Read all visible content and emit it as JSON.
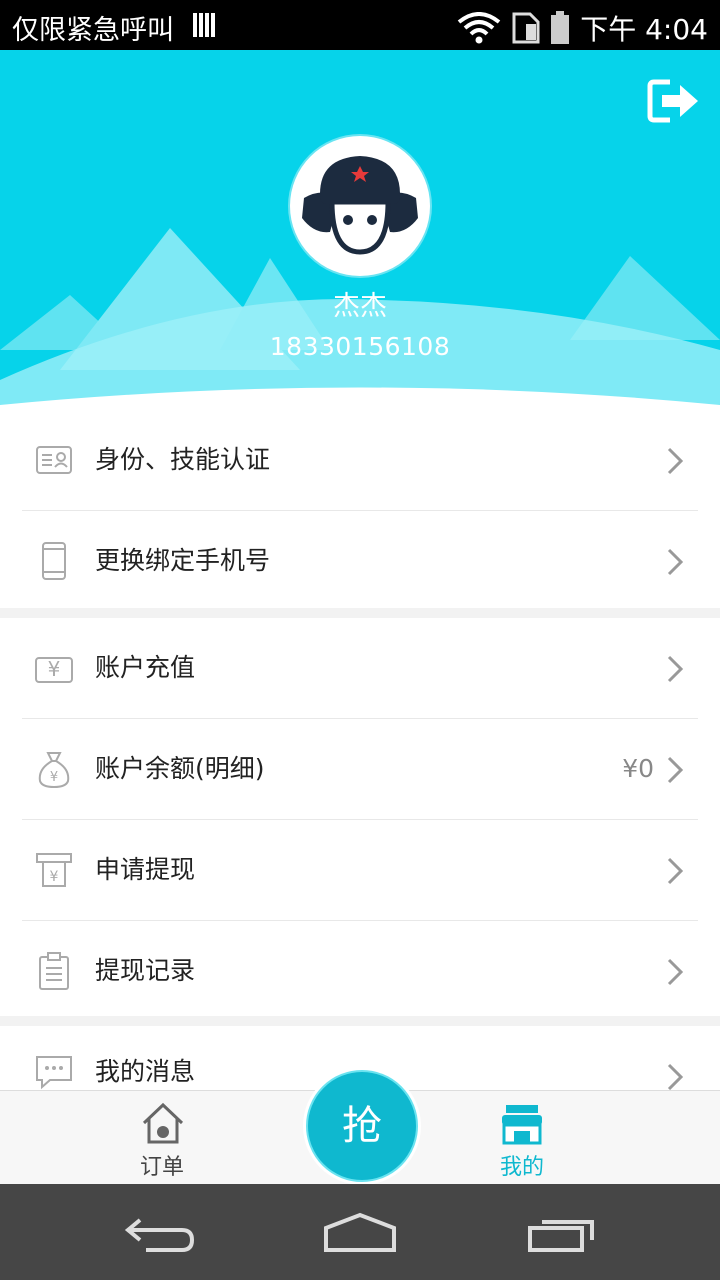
{
  "status_bar": {
    "carrier": "仅限紧急呼叫",
    "time": "下午 4:04"
  },
  "profile": {
    "name": "杰杰",
    "phone": "18330156108"
  },
  "section1": [
    {
      "label": "身份、技能认证",
      "icon": "id-card-icon"
    },
    {
      "label": "更换绑定手机号",
      "icon": "phone-icon"
    }
  ],
  "section2": [
    {
      "label": "账户充值",
      "icon": "recharge-icon"
    },
    {
      "label": "账户余额(明细)",
      "icon": "money-bag-icon",
      "value": "¥0"
    },
    {
      "label": "申请提现",
      "icon": "withdraw-icon"
    },
    {
      "label": "提现记录",
      "icon": "clipboard-icon"
    }
  ],
  "section3": [
    {
      "label": "我的消息",
      "icon": "message-icon"
    }
  ],
  "tabs": {
    "orders": "订单",
    "grab": "抢",
    "mine": "我的"
  },
  "colors": {
    "accent": "#06d3ea",
    "tab_active": "#0fb8cf",
    "grab_button": "#0fb8cf"
  }
}
